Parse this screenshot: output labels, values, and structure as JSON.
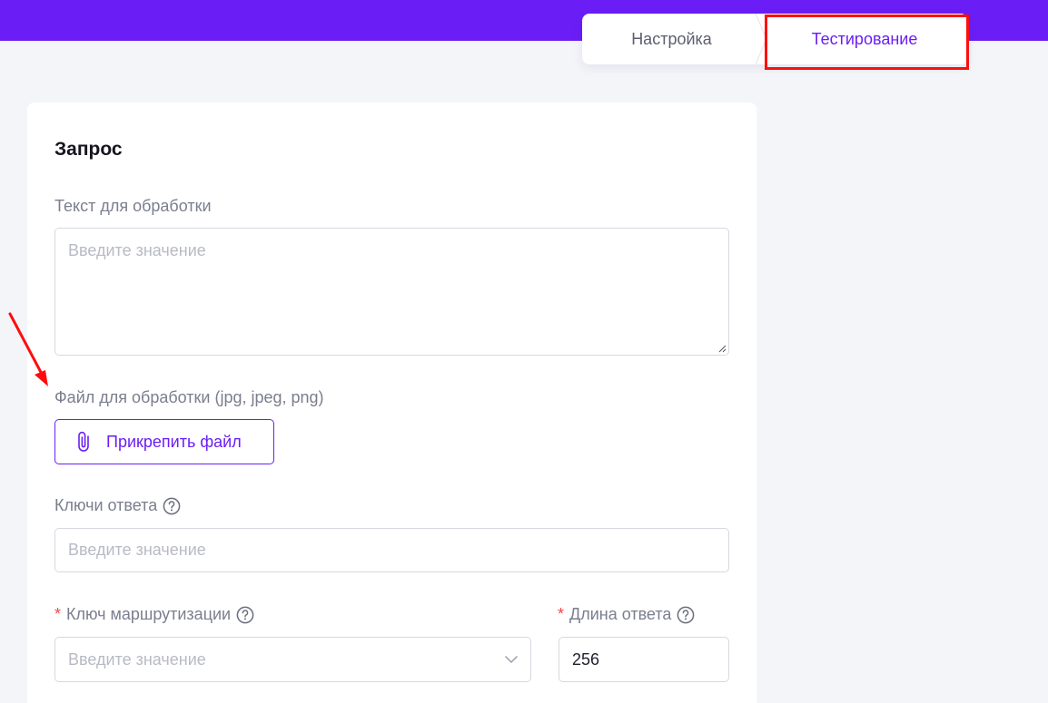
{
  "tabs": {
    "setup_label": "Настройка",
    "test_label": "Тестирование"
  },
  "request": {
    "title": "Запрос",
    "text_label": "Текст для обработки",
    "text_placeholder": "Введите значение",
    "file_label": "Файл для обработки (jpg, jpeg, png)",
    "attach_label": "Прикрепить файл",
    "keys_label": "Ключи ответа",
    "keys_placeholder": "Введите значение",
    "routing_label": "Ключ маршрутизации",
    "routing_placeholder": "Введите значение",
    "length_label": "Длина ответа",
    "length_value": "256",
    "required_mark": "*"
  },
  "colors": {
    "accent": "#6a1ef5",
    "annotation": "#ff0d0d",
    "required": "#f04848"
  },
  "icons": {
    "attach": "paperclip-icon",
    "help": "question-circle-icon",
    "dropdown": "chevron-down-icon"
  }
}
